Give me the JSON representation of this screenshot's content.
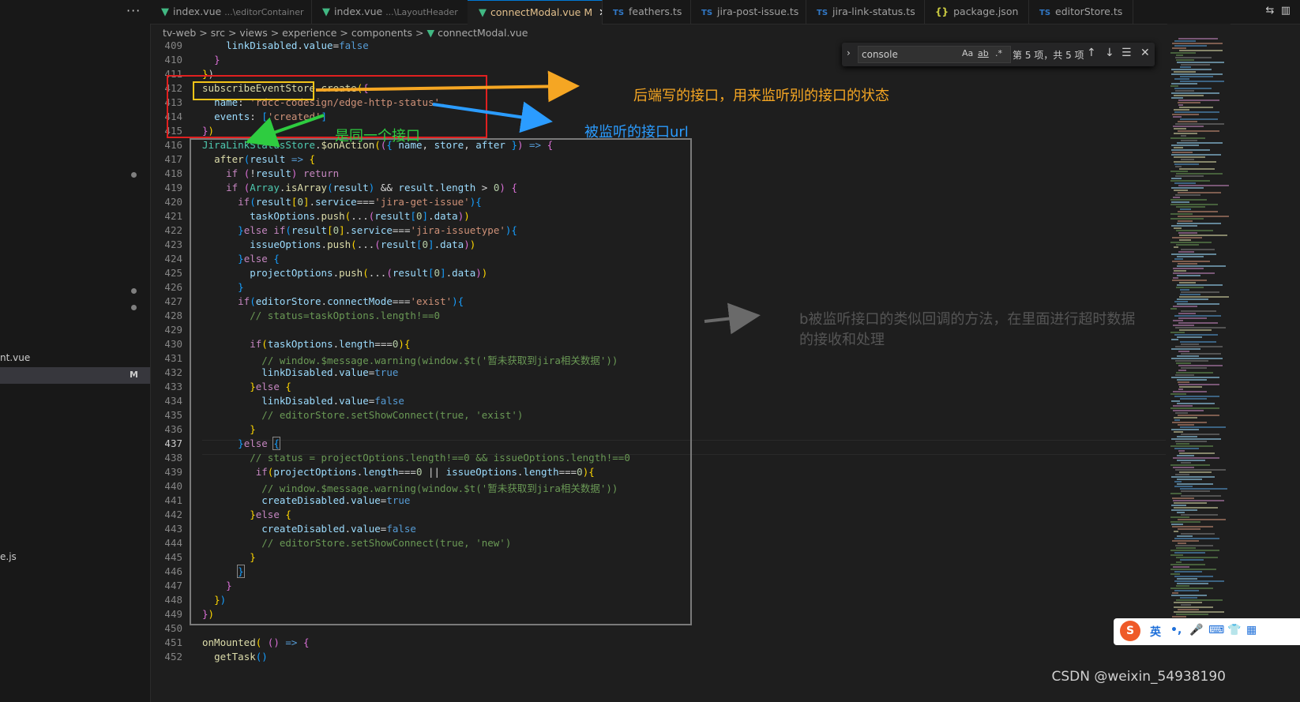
{
  "sidebar": {
    "more": "···",
    "item_vue": "nt.vue",
    "item_js": "e.js",
    "modified": "M"
  },
  "tabs": [
    {
      "icon": "vue",
      "name": "index.vue",
      "path": "...\\editorContainer"
    },
    {
      "icon": "vue",
      "name": "index.vue",
      "path": "...\\LayoutHeader"
    },
    {
      "icon": "vue",
      "name": "connectModal.vue",
      "path": "",
      "mark": "M",
      "close": "✕"
    },
    {
      "icon": "TS",
      "name": "feathers.ts",
      "path": ""
    },
    {
      "icon": "TS",
      "name": "jira-post-issue.ts",
      "path": ""
    },
    {
      "icon": "TS",
      "name": "jira-link-status.ts",
      "path": ""
    },
    {
      "icon": "{}",
      "name": "package.json",
      "path": ""
    },
    {
      "icon": "TS",
      "name": "editorStore.ts",
      "path": ""
    }
  ],
  "breadcrumb": [
    "tv-web",
    "src",
    "views",
    "experience",
    "components",
    "connectModal.vue"
  ],
  "find": {
    "query": "console",
    "match_case": "Aa",
    "whole_word": "ab",
    "regex": ".*",
    "count": "第 5 项，共 5 项"
  },
  "line_numbers": [
    "409",
    "410",
    "411",
    "412",
    "413",
    "414",
    "415",
    "416",
    "417",
    "418",
    "419",
    "420",
    "421",
    "422",
    "423",
    "424",
    "425",
    "426",
    "427",
    "428",
    "429",
    "430",
    "431",
    "432",
    "433",
    "434",
    "435",
    "436",
    "437",
    "438",
    "439",
    "440",
    "441",
    "442",
    "443",
    "444",
    "445",
    "446",
    "447",
    "448",
    "449",
    "450",
    "451",
    "452"
  ],
  "current_line": "437",
  "annotations": {
    "backend_api": "后端写的接口，用来监听别的接口的状态",
    "watched_url": "被监听的接口url",
    "same_api": "是同一个接口",
    "callback_line1": "b被监听接口的类似回调的方法，在里面进行超时数据",
    "callback_line2": "的接收和处理"
  },
  "ime": {
    "lang": "英"
  },
  "watermark": "CSDN @weixin_54938190",
  "colors": {
    "annotation_orange": "#f5a623",
    "annotation_blue": "#2b9cff",
    "annotation_green": "#2ecc40",
    "annotation_gray": "#6a6a6a",
    "box_red": "#e02020",
    "box_yellow": "#f5c518"
  }
}
